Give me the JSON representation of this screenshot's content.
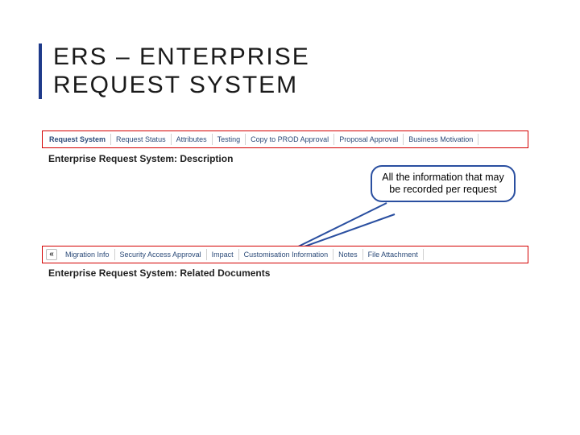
{
  "title_line1": "ERS – ENTERPRISE",
  "title_line2": "REQUEST SYSTEM",
  "tabs1": {
    "t0": "Request System",
    "t1": "Request Status",
    "t2": "Attributes",
    "t3": "Testing",
    "t4": "Copy to PROD Approval",
    "t5": "Proposal Approval",
    "t6": "Business Motivation"
  },
  "subheading1": "Enterprise Request System: Description",
  "tabs2": {
    "collapse": "«",
    "t0": "Migration Info",
    "t1": "Security Access Approval",
    "t2": "Impact",
    "t3": "Customisation Information",
    "t4": "Notes",
    "t5": "File Attachment"
  },
  "subheading2": "Enterprise Request System: Related Documents",
  "callout": "All the information that may be recorded per request"
}
